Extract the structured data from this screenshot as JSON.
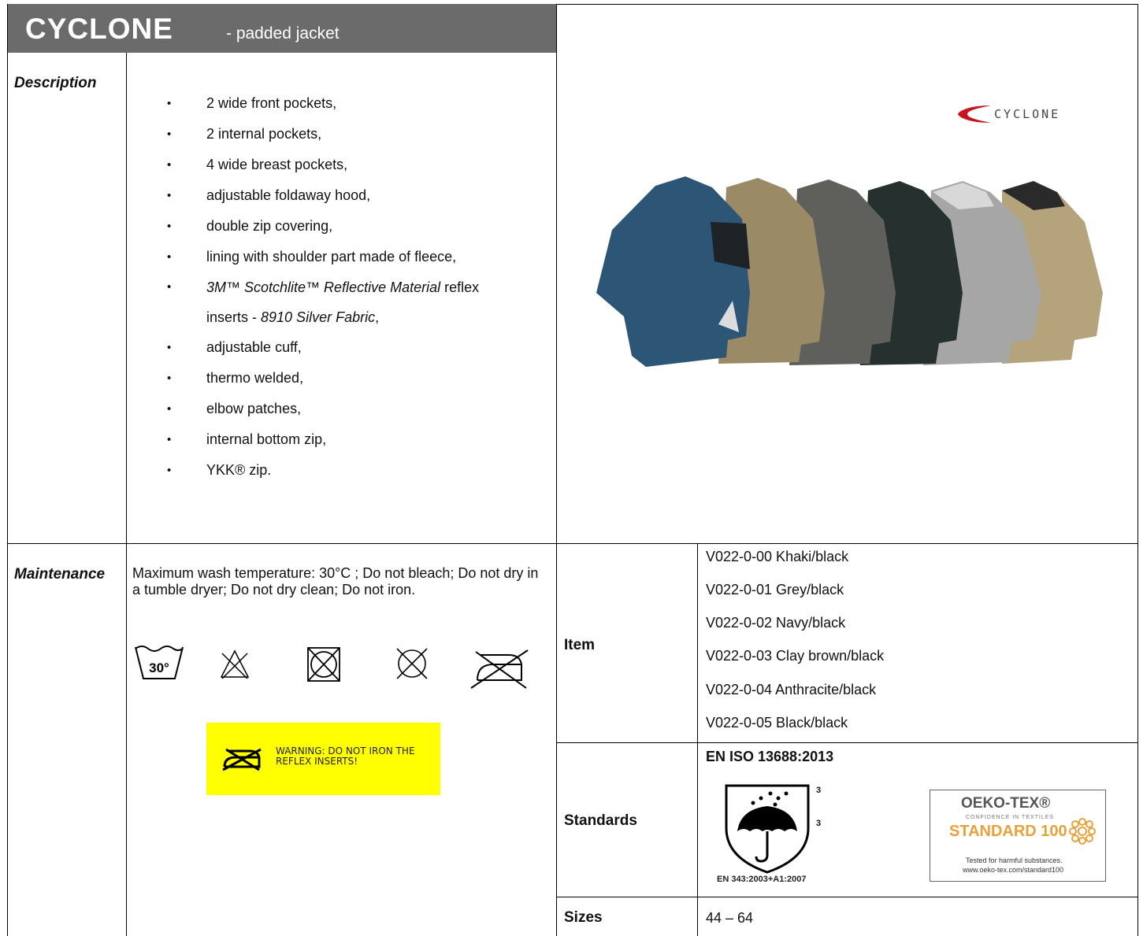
{
  "header": {
    "product_name": "CYCLONE",
    "subtitle": "- padded jacket"
  },
  "description": {
    "label": "Description",
    "features": [
      "2 wide front pockets,",
      "2 internal pockets,",
      "4 wide breast pockets,",
      "adjustable foldaway hood,",
      "double zip covering,",
      "lining with shoulder part made of fleece,"
    ],
    "reflective_feature": {
      "brand_italic": "3M™ Scotchlite™ Reflective Material",
      "text_after_brand": " reflex",
      "text_line2_before": "inserts - ",
      "fabric_italic": "8910 Silver Fabric",
      "text_line2_after": ","
    },
    "features_after": [
      "adjustable cuff,",
      "thermo welded,",
      "elbow patches,",
      "internal bottom zip,",
      "YKK® zip."
    ]
  },
  "image": {
    "logo_text": "CYCLONE",
    "jacket_colors": [
      "#2d5576",
      "#9a8a65",
      "#5f605c",
      "#26302f",
      "#a5a6a5",
      "#b5a37b"
    ]
  },
  "maintenance": {
    "label": "Maintenance",
    "instructions": "Maximum wash temperature: 30°C ; Do not bleach; Do not dry in a tumble dryer; Do not dry clean; Do not iron.",
    "wash_symbol_text": "30°",
    "care_symbols": [
      "wash-30-icon",
      "no-bleach-icon",
      "no-tumble-dry-icon",
      "no-dry-clean-icon",
      "no-iron-icon"
    ],
    "warning_line1": "WARNING: DO NOT IRON THE",
    "warning_line2": "REFLEX INSERTS!",
    "warning_bg": "#ffff00"
  },
  "item": {
    "label": "Item",
    "variants": [
      "V022-0-00 Khaki/black",
      "V022-0-01 Grey/black",
      "V022-0-02 Navy/black",
      "V022-0-03 Clay brown/black",
      "V022-0-04 Anthracite/black",
      "V022-0-05 Black/black"
    ]
  },
  "standards": {
    "label": "Standards",
    "norm": "EN ISO 13688:2013",
    "en343_caption": "EN 343:2003+A1:2007",
    "en343_level_1": "3",
    "en343_level_2": "3",
    "oeko_name": "OEKO-TEX®",
    "oeko_confidence": "CONFIDENCE IN TEXTILES",
    "oeko_standard": "STANDARD 100",
    "oeko_tested": "Tested for harmful substances.",
    "oeko_url": "www.oeko-tex.com/standard100",
    "oeko_accent": "#e8a23a"
  },
  "sizes": {
    "label": "Sizes",
    "value": "44 – 64"
  }
}
